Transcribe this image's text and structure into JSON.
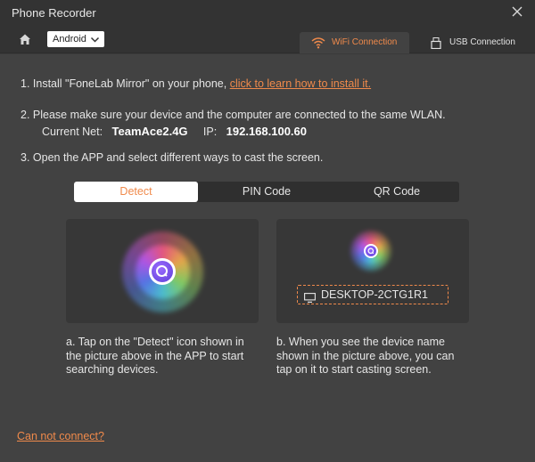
{
  "window": {
    "title": "Phone Recorder",
    "close_icon": "close-icon"
  },
  "toolbar": {
    "home_icon": "home-icon",
    "os_selected": "Android",
    "tabs": [
      {
        "label": "WiFi Connection",
        "icon": "wifi-icon",
        "active": true
      },
      {
        "label": "USB Connection",
        "icon": "usb-icon",
        "active": false
      }
    ]
  },
  "steps": {
    "step1_text": "1. Install \"FoneLab Mirror\" on your phone, ",
    "step1_link": "click to learn how to install it.",
    "step2_text": "2. Please make sure your device and the computer are connected to the same WLAN.",
    "current_net_label": "Current Net:",
    "current_net_value": "TeamAce2.4G",
    "ip_label": "IP:",
    "ip_value": "192.168.100.60",
    "step3_text": "3. Open the APP and select different ways to cast the screen."
  },
  "methods": {
    "tabs": [
      {
        "label": "Detect",
        "active": true
      },
      {
        "label": "PIN Code",
        "active": false
      },
      {
        "label": "QR Code",
        "active": false
      }
    ]
  },
  "cards": {
    "device_name": "DESKTOP-2CTG1R1",
    "desc_a": "a. Tap on the \"Detect\" icon shown in the picture above in the APP to start searching devices.",
    "desc_b": "b. When you see the device name shown in the picture above, you can tap on it to start casting screen."
  },
  "footer": {
    "help_link": "Can not connect?"
  },
  "colors": {
    "accent": "#f08a4b",
    "background": "#424242",
    "titlebar": "#333333"
  }
}
